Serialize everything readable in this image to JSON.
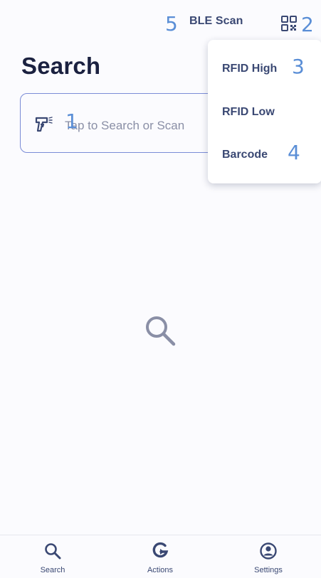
{
  "header": {
    "ble_scan_label": "BLE Scan",
    "title": "Search"
  },
  "search": {
    "placeholder": "Tap to Search or Scan"
  },
  "dropdown": {
    "items": [
      {
        "label": "RFID High"
      },
      {
        "label": "RFID Low"
      },
      {
        "label": "Barcode"
      }
    ]
  },
  "annotations": [
    "1",
    "2",
    "3",
    "4",
    "5"
  ],
  "bottom_nav": {
    "items": [
      {
        "label": "Search",
        "icon": "search-icon"
      },
      {
        "label": "Actions",
        "icon": "actions-icon"
      },
      {
        "label": "Settings",
        "icon": "settings-icon"
      }
    ]
  },
  "colors": {
    "accent": "#3a4873",
    "border": "#7a8bd6",
    "annotation": "#5a8ed6",
    "background": "#fbfbfe"
  }
}
